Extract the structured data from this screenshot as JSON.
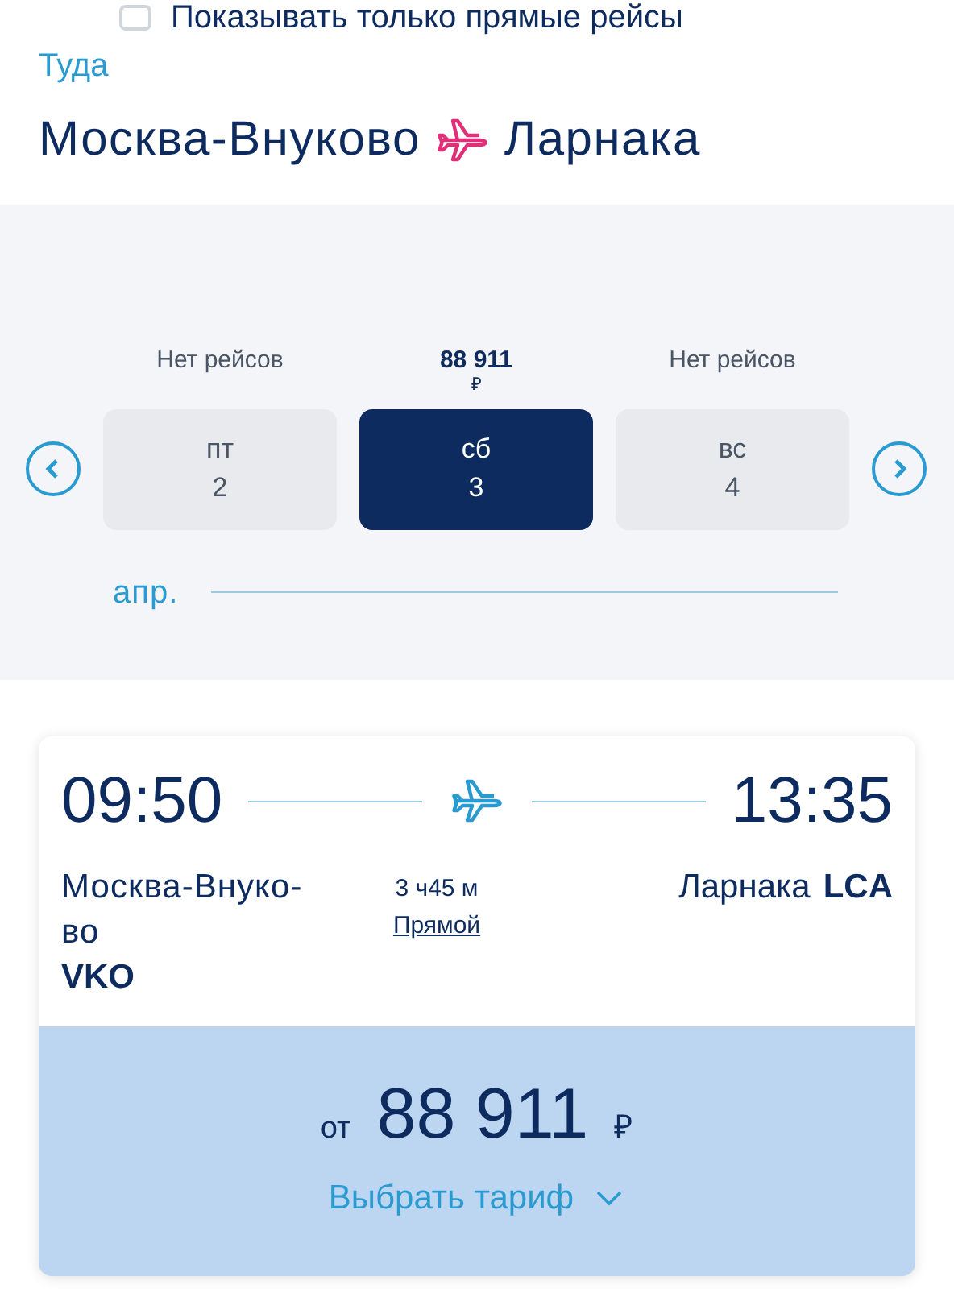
{
  "direct_only": {
    "label": "Показывать только прямые рейсы",
    "checked": false
  },
  "direction": "Туда",
  "route": {
    "from": "Москва-Внуково",
    "to": "Ларнака"
  },
  "dates": [
    {
      "price": "Нет рейсов",
      "weekday": "пт",
      "day": "2",
      "selected": false
    },
    {
      "price": "88 911",
      "currency": "₽",
      "weekday": "сб",
      "day": "3",
      "selected": true
    },
    {
      "price": "Нет рейсов",
      "weekday": "вс",
      "day": "4",
      "selected": false
    }
  ],
  "month": "апр.",
  "flight": {
    "departure_time": "09:50",
    "arrival_time": "13:35",
    "from_city": "Москва-Внуко-во",
    "from_code": "VKO",
    "duration": "3 ч45 м",
    "stops": "Прямой",
    "to_city": "Ларнака",
    "to_code": "LCA",
    "price_prefix": "от",
    "price": "88 911",
    "currency": "₽",
    "fare_button": "Выбрать тариф"
  }
}
